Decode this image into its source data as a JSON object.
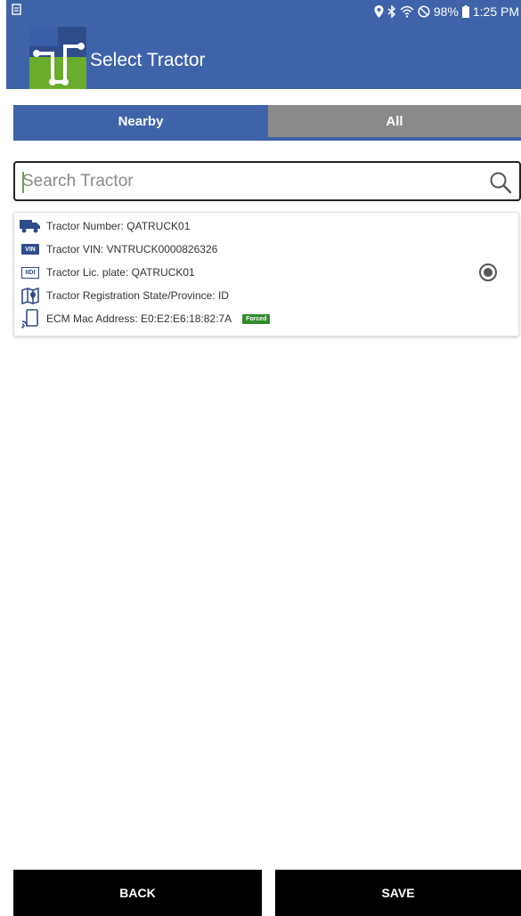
{
  "status_bar": {
    "battery": "98%",
    "time": "1:25 PM",
    "icons": [
      "location-icon",
      "bluetooth-icon",
      "wifi-icon",
      "do-not-disturb-icon",
      "battery-icon"
    ]
  },
  "app": {
    "title": "Select Tractor",
    "brand_colors": {
      "header": "#3f63a8",
      "logo_green": "#6aac2c",
      "logo_blue": "#2f4c8c"
    }
  },
  "tabs": [
    {
      "label": "Nearby",
      "active": true
    },
    {
      "label": "All",
      "active": false
    }
  ],
  "search": {
    "placeholder": "Search Tractor",
    "value": ""
  },
  "tractors": [
    {
      "number": "Tractor Number: QATRUCK01",
      "vin": "Tractor VIN: VNTRUCK0000826326",
      "plate": "Tractor Lic. plate: QATRUCK01",
      "registration": "Tractor Registration State/Province: ID",
      "ecm": "ECM Mac Address: E0:E2:E6:18:82:7A",
      "badge": "Forced",
      "vin_icon_text": "VIN",
      "plate_icon_text": "IIDI",
      "selected": true
    }
  ],
  "buttons": {
    "back": "BACK",
    "save": "SAVE"
  }
}
